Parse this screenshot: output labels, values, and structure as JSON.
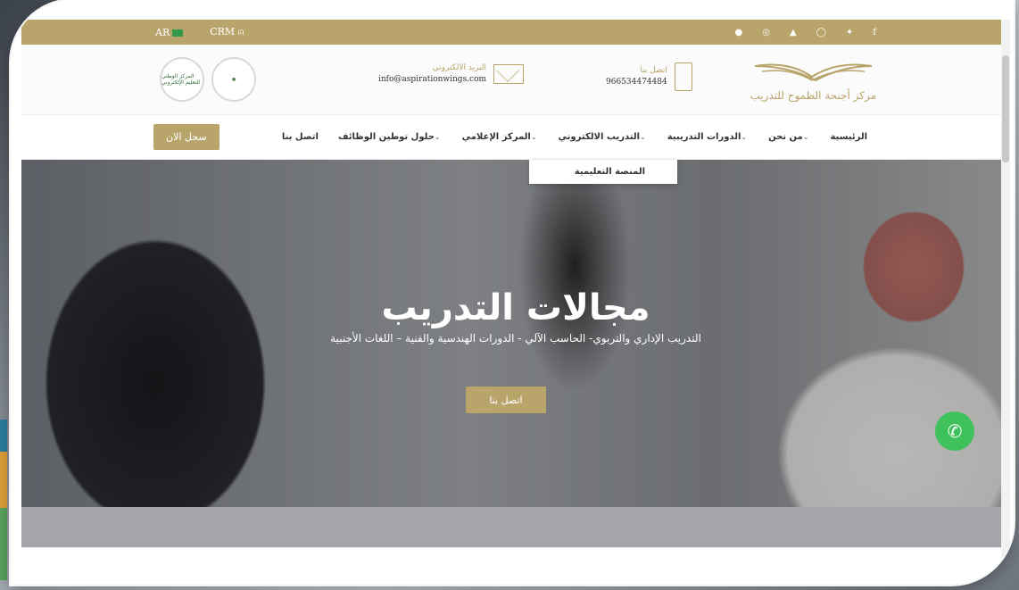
{
  "topbar": {
    "lang": "AR",
    "crm": "CRM",
    "social": [
      "telegram-icon",
      "instagram-icon",
      "youtube-icon",
      "whatsapp-icon",
      "twitter-icon",
      "facebook-icon"
    ]
  },
  "header": {
    "email_label": "البريد الالكتروني",
    "email": "info@aspirationwings.com",
    "phone_label": "اتصل بنا",
    "phone": "966534474484",
    "brand_name": "مركز أجنحة الطموح للتدريب",
    "badge1": "المركز الوطني للتعليم الإلكتروني"
  },
  "nav": {
    "register": "سجل الان",
    "items": [
      "الرئيسية",
      "من نحن",
      "الدورات التدريبية",
      "التدريب الالكتروني",
      "المركز الإعلامي",
      "حلول توطين الوظائف",
      "اتصل بنا"
    ],
    "dropdown_item": "المنصة التعليمية"
  },
  "hero": {
    "title": "مجالات التدريب",
    "subtitle": "التدريب الإداري والتربوي- الحاسب الآلي - الدورات الهندسية والفنية – اللغات الأجنبية",
    "button": "اتصل بنا"
  },
  "colors": {
    "accent": "#b9a56b",
    "whatsapp": "#3fc25c"
  }
}
